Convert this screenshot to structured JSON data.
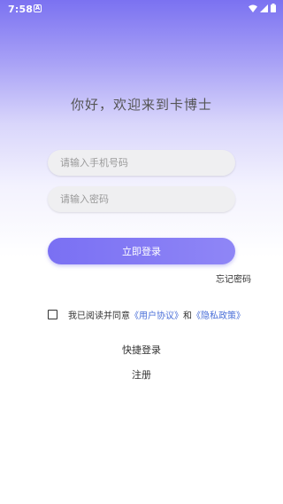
{
  "status_bar": {
    "time": "7:58",
    "notification_glyph": "A",
    "icons": [
      "wifi-icon",
      "signal-icon",
      "battery-icon"
    ]
  },
  "greeting": "你好，欢迎来到卡博士",
  "form": {
    "phone_placeholder": "请输入手机号码",
    "password_placeholder": "请输入密码",
    "phone_value": "",
    "password_value": ""
  },
  "login_button": "立即登录",
  "forgot_password": "忘记密码",
  "agreement": {
    "checked": false,
    "prefix": "我已阅读并同意",
    "user_agreement": "《用户协议》",
    "conjunction": "和",
    "privacy_policy": "《隐私政策》"
  },
  "quick_login": "快捷登录",
  "register": "注册",
  "colors": {
    "accent": "#7b72f1",
    "link": "#4a6fd8",
    "input_bg": "#efeff1"
  }
}
